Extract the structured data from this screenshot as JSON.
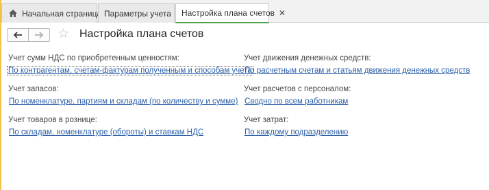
{
  "tabs": [
    {
      "label": "Начальная страница"
    },
    {
      "label": "Параметры учета"
    },
    {
      "label": "Настройка плана счетов"
    }
  ],
  "close_glyph": "✕",
  "toolbar": {
    "back_glyph": "🡐",
    "forward_glyph": "🡒",
    "favorite_glyph": "☆"
  },
  "page": {
    "title": "Настройка плана счетов"
  },
  "settings": {
    "vat": {
      "label": "Учет сумм НДС по приобретенным ценностям:",
      "value": "По контрагентам, счетам-фактурам полученным и способам учета"
    },
    "inventory": {
      "label": "Учет запасов:",
      "value": "По номенклатуре, партиям и складам (по количеству и сумме)"
    },
    "retail": {
      "label": "Учет товаров в рознице:",
      "value": "По складам, номенклатуре (обороты) и ставкам НДС"
    },
    "cash": {
      "label": "Учет движения денежных средств:",
      "value": "По расчетным счетам и статьям движения денежных средств"
    },
    "personnel": {
      "label": "Учет расчетов с персоналом:",
      "value": "Сводно по всем работникам"
    },
    "costs": {
      "label": "Учет затрат:",
      "value": "По каждому подразделению"
    }
  },
  "colors": {
    "accent_green": "#4ca04c",
    "link_blue": "#2a5ea8",
    "left_strip": "#f0c24a"
  }
}
